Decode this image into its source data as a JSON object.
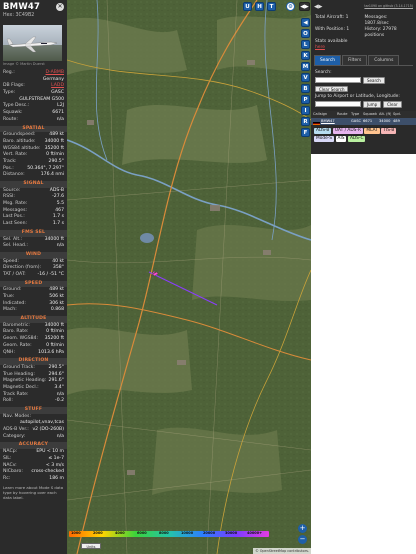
{
  "aircraft": {
    "callsign": "BMW47",
    "hex_label": "Hex:",
    "hex": "3C49B2",
    "photo_credit": "Image © Martin Duerst"
  },
  "reg_info": [
    {
      "k": "Reg.:",
      "v": "D-ABMB",
      "link": true
    },
    {
      "k": "",
      "v": "Germany",
      "link": false
    },
    {
      "k": "DB Flags:",
      "v": "LADD",
      "link": true
    },
    {
      "k": "Type:",
      "v": "GASC",
      "link": false
    },
    {
      "k": "",
      "v": "GULFSTREAM G500",
      "link": false
    },
    {
      "k": "Type Desc.:",
      "v": "L2J",
      "link": false
    },
    {
      "k": "Squawk:",
      "v": "6671",
      "link": false
    },
    {
      "k": "Route:",
      "v": "n/a",
      "link": false
    }
  ],
  "sections": [
    {
      "title": "SPATIAL",
      "rows": [
        {
          "k": "Groundspeed:",
          "v": "489 kt"
        },
        {
          "k": "Baro. altitude:",
          "v": "34000 ft"
        },
        {
          "k": "WGS84 altitude:",
          "v": "35200 ft"
        },
        {
          "k": "Vert. Rate:",
          "v": "0 ft/min"
        },
        {
          "k": "Track:",
          "v": "290.5°"
        },
        {
          "k": "Pos.:",
          "v": "50.364°, 7.297°"
        },
        {
          "k": "Distance:",
          "v": "176.4 nmi"
        }
      ]
    },
    {
      "title": "SIGNAL",
      "rows": [
        {
          "k": "Source:",
          "v": "ADS-B"
        },
        {
          "k": "RSSI:",
          "v": "-27.6"
        },
        {
          "k": "Msg. Rate:",
          "v": "5.5"
        },
        {
          "k": "Messages:",
          "v": "467"
        },
        {
          "k": "Last Pos.:",
          "v": "1.7 s"
        },
        {
          "k": "Last Seen:",
          "v": "1.7 s"
        }
      ]
    },
    {
      "title": "FMS SEL",
      "rows": [
        {
          "k": "Sel. Alt.:",
          "v": "34000 ft"
        },
        {
          "k": "Sel. Head.:",
          "v": "n/a"
        }
      ]
    },
    {
      "title": "WIND",
      "rows": [
        {
          "k": "Speed:",
          "v": "40 kt"
        },
        {
          "k": "Direction (from):",
          "v": "358°"
        },
        {
          "k": "TAT / OAT:",
          "v": "-16 / -51 °C"
        }
      ]
    },
    {
      "title": "SPEED",
      "rows": [
        {
          "k": "Ground:",
          "v": "489 kt"
        },
        {
          "k": "True:",
          "v": "506 kt"
        },
        {
          "k": "Indicated:",
          "v": "306 kt"
        },
        {
          "k": "Mach:",
          "v": "0.868"
        }
      ]
    },
    {
      "title": "ALTITUDE",
      "rows": [
        {
          "k": "Barometric:",
          "v": "34000 ft"
        },
        {
          "k": "Baro. Rate:",
          "v": "0 ft/min"
        },
        {
          "k": "Geom. WGS84:",
          "v": "35200 ft"
        },
        {
          "k": "Geom. Rate:",
          "v": "0 ft/min"
        },
        {
          "k": "QNH:",
          "v": "1013.6 hPa"
        }
      ]
    },
    {
      "title": "DIRECTION",
      "rows": [
        {
          "k": "Ground Track:",
          "v": "290.5°"
        },
        {
          "k": "True Heading:",
          "v": "294.6°"
        },
        {
          "k": "Magnetic Heading:",
          "v": "291.6°"
        },
        {
          "k": "Magnetic Decl.:",
          "v": "3.4°"
        },
        {
          "k": "Track Rate:",
          "v": "n/a"
        },
        {
          "k": "Roll:",
          "v": "-0.2"
        }
      ]
    },
    {
      "title": "STUFF",
      "rows": [
        {
          "k": "Nav. Modes:",
          "v": ""
        },
        {
          "k": "",
          "v": "autopilot,vnav,tcas"
        },
        {
          "k": "ADS-B Ver.:",
          "v": "v2 (DO-260B)"
        },
        {
          "k": "Category:",
          "v": "n/a"
        }
      ]
    },
    {
      "title": "ACCURACY",
      "rows": [
        {
          "k": "NACp:",
          "v": "EPU < 10 m"
        },
        {
          "k": "SIL:",
          "v": "≤ 1e-7"
        },
        {
          "k": "NACv:",
          "v": "< 3 m/s"
        },
        {
          "k": "NICbaro:",
          "v": "cross-checked"
        },
        {
          "k": "Rc:",
          "v": "186 m"
        }
      ]
    }
  ],
  "footer_text": "Learn more about Mode S data type by hovering over each data label.",
  "map": {
    "top_buttons": [
      "U",
      "H",
      "T"
    ],
    "side_buttons": [
      "◀",
      "O",
      "L",
      "K",
      "M",
      "V",
      "B",
      "P",
      "I",
      "R",
      "F"
    ],
    "zoom_in": "+",
    "zoom_out": "−",
    "legend_labels": [
      "1000",
      "2000",
      "4000",
      "6000",
      "8000",
      "10000",
      "20000",
      "30000",
      "40000+"
    ],
    "units_button": "Units",
    "attribution": "© OpenStreetMap contributors."
  },
  "right": {
    "version": "tar1090 on github (3.14.1715)",
    "total_aircraft_label": "Total Aircraft:",
    "total_aircraft": "1",
    "with_position_label": "With Position:",
    "with_position": "1",
    "stats_link": "Stats available",
    "stats_link2": "here",
    "messages_label": "Messages:",
    "messages": "1807.8/sec",
    "history_label": "History:",
    "history": "27978 positions",
    "tabs": [
      "Search",
      "Filters",
      "Columns"
    ],
    "search_label": "Search:",
    "search_button": "Search",
    "clear_search": "Clear Search",
    "jump_label": "Jump to Airport or Latitude, Longitude:",
    "jump_button": "Jump",
    "clear_button": "Clear",
    "columns": [
      "Callsign",
      "Route",
      "Type",
      "Squawk",
      "Alt. (ft)",
      "Spd."
    ],
    "row": {
      "callsign": "BMW47",
      "type": "GASC",
      "squawk": "6671",
      "alt": "34000",
      "spd": "489"
    },
    "sources": [
      {
        "label": "ADS-B",
        "bg": "#b7dcef"
      },
      {
        "label": "UAT / ADS-R",
        "bg": "#e7b5ee"
      },
      {
        "label": "MLAT",
        "bg": "#ffc38f"
      },
      {
        "label": "TIS-B",
        "bg": "#f5b5b5"
      },
      {
        "label": "Mode-S",
        "bg": "#d8d8f7"
      },
      {
        "label": "AIS",
        "bg": "#ffffff"
      },
      {
        "label": "ADS-C",
        "bg": "#b9f0a0"
      }
    ]
  }
}
